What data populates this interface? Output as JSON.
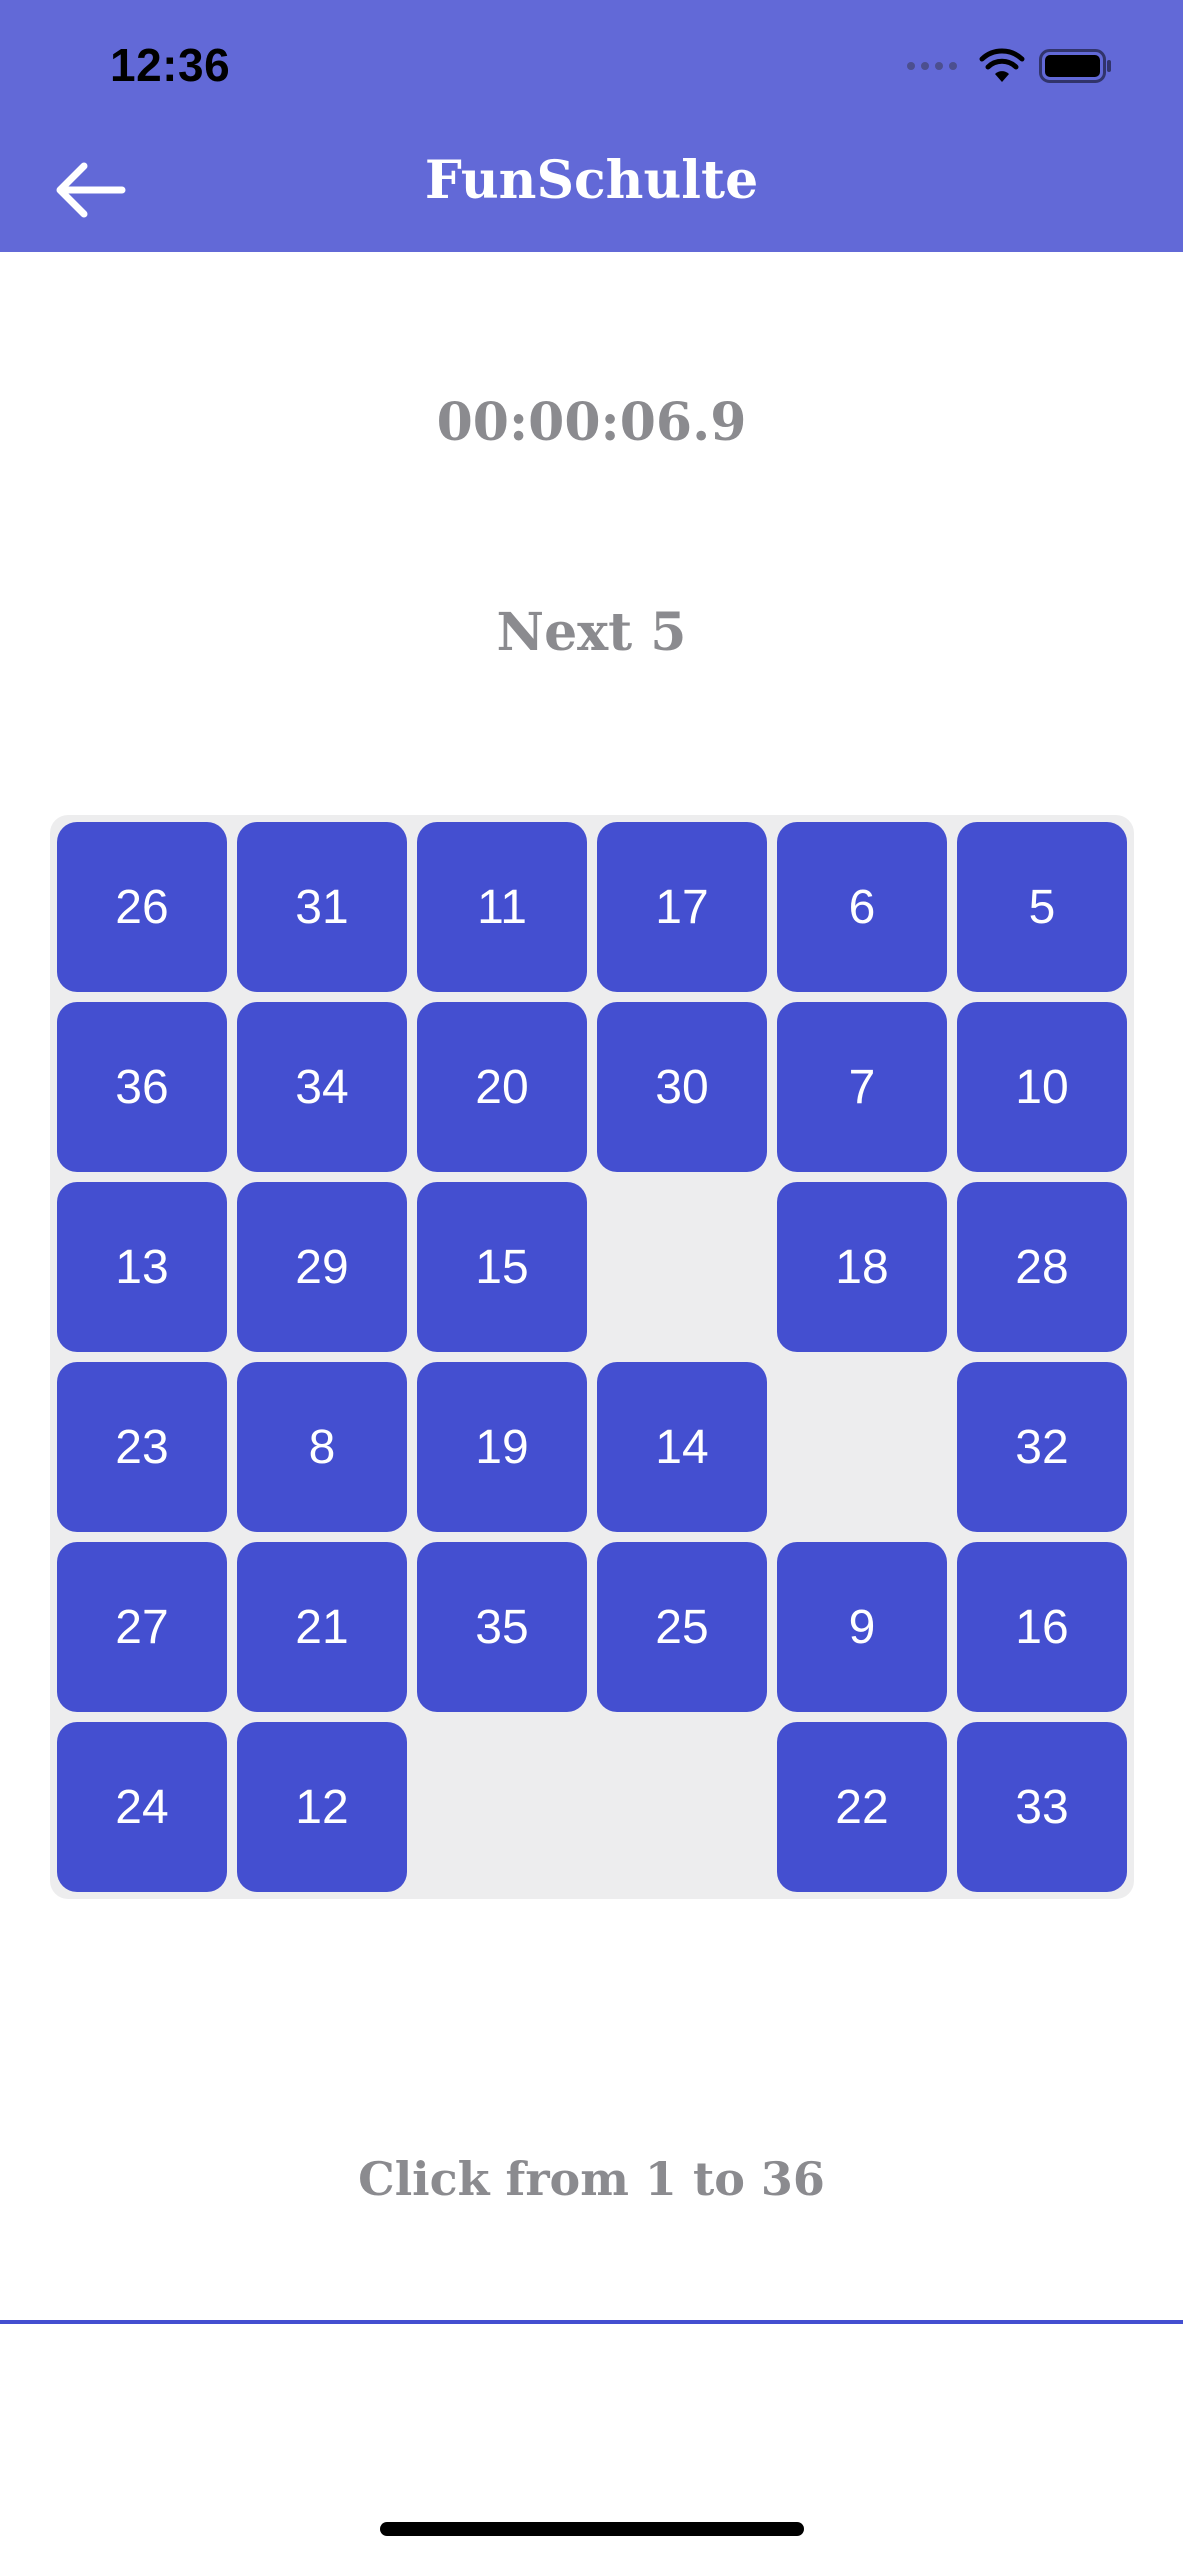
{
  "status_bar": {
    "time": "12:36",
    "icons": [
      "signal-dots-icon",
      "wifi-icon",
      "battery-icon"
    ]
  },
  "header": {
    "title": "FunSchulte",
    "back_icon": "arrow-left-icon",
    "background_color": "#6269d7"
  },
  "game": {
    "timer": "00:00:06.9",
    "next_label": "Next 5",
    "tile_color": "#444fd0",
    "board_color": "#ededee",
    "grid": [
      [
        "26",
        "31",
        "11",
        "17",
        "6",
        "5"
      ],
      [
        "36",
        "34",
        "20",
        "30",
        "7",
        "10"
      ],
      [
        "13",
        "29",
        "15",
        "",
        "18",
        "28"
      ],
      [
        "23",
        "8",
        "19",
        "14",
        "",
        "32"
      ],
      [
        "27",
        "21",
        "35",
        "25",
        "9",
        "16"
      ],
      [
        "24",
        "12",
        "",
        "",
        "22",
        "33"
      ]
    ]
  },
  "footer": {
    "hint": "Click from 1 to 36"
  }
}
